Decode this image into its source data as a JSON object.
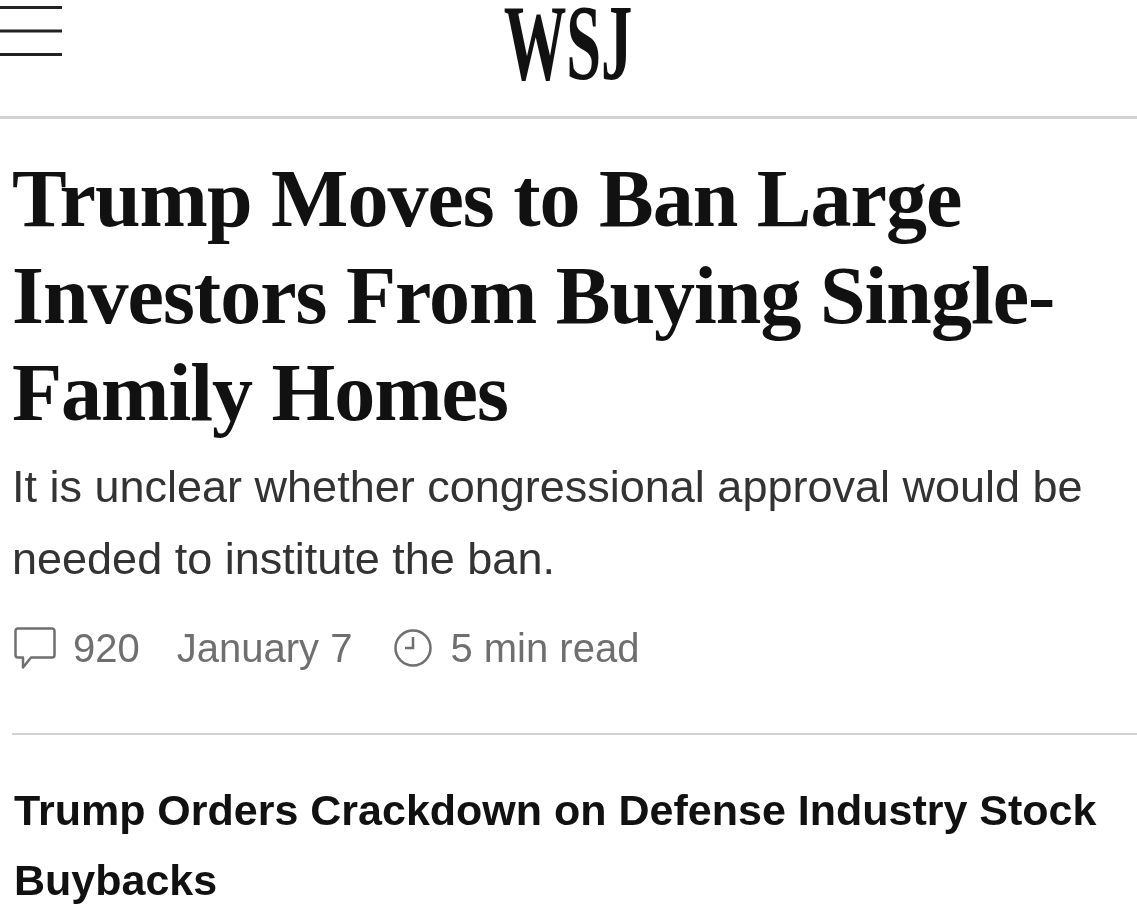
{
  "header": {
    "logo": "WSJ"
  },
  "lead_story": {
    "headline": "Trump Moves to Ban Large Investors From Buying Single-Family Homes",
    "summary": "It is unclear whether congressional approval would be needed to institute the ban.",
    "comments": "920",
    "date": "January 7",
    "read_time": "5 min read"
  },
  "stories": [
    {
      "headline": "Trump Orders Crackdown on Defense Industry Stock Buybacks"
    }
  ]
}
